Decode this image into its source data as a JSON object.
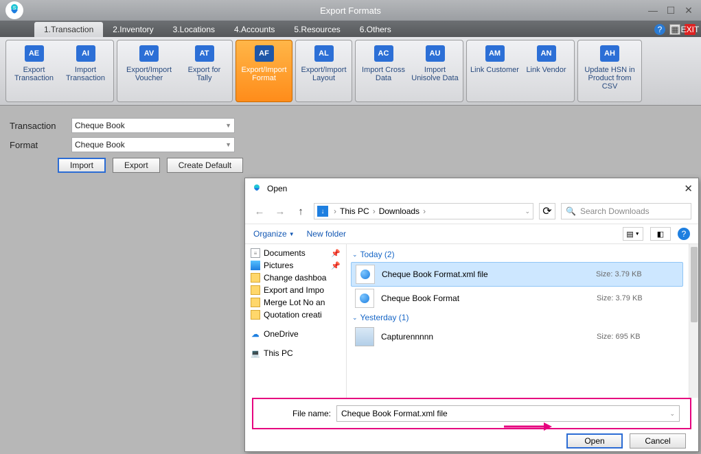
{
  "window": {
    "title": "Export Formats"
  },
  "tabs": [
    "1.Transaction",
    "2.Inventory",
    "3.Locations",
    "4.Accounts",
    "5.Resources",
    "6.Others"
  ],
  "active_tab": 0,
  "ribbon": [
    {
      "items": [
        {
          "label": "Export Transaction",
          "code": "AE"
        },
        {
          "label": "Import Transaction",
          "code": "AI"
        }
      ]
    },
    {
      "items": [
        {
          "label": "Export/Import Voucher",
          "code": "AV"
        },
        {
          "label": "Export for Tally",
          "code": "AT"
        }
      ]
    },
    {
      "items": [
        {
          "label": "Export/Import Format",
          "code": "AF"
        }
      ],
      "highlight": true
    },
    {
      "items": [
        {
          "label": "Export/Import Layout",
          "code": "AL"
        }
      ]
    },
    {
      "items": [
        {
          "label": "Import Cross Data",
          "code": "AC"
        },
        {
          "label": "Import Unisolve Data",
          "code": "AU"
        }
      ]
    },
    {
      "items": [
        {
          "label": "Link Customer",
          "code": "AM"
        },
        {
          "label": "Link Vendor",
          "code": "AN"
        }
      ]
    },
    {
      "items": [
        {
          "label": "Update HSN in Product from CSV",
          "code": "AH"
        }
      ]
    }
  ],
  "form": {
    "transaction_label": "Transaction",
    "transaction_value": "Cheque Book",
    "format_label": "Format",
    "format_value": "Cheque Book",
    "buttons": {
      "import": "Import",
      "export": "Export",
      "create_default": "Create Default"
    }
  },
  "dialog": {
    "title": "Open",
    "breadcrumb": [
      "This PC",
      "Downloads"
    ],
    "search_placeholder": "Search Downloads",
    "toolbar": {
      "organize": "Organize",
      "new_folder": "New folder"
    },
    "tree": [
      {
        "label": "Documents",
        "icon": "doc",
        "pinned": true
      },
      {
        "label": "Pictures",
        "icon": "pic",
        "pinned": true
      },
      {
        "label": "Change dashboa",
        "icon": "folder"
      },
      {
        "label": "Export and Impo",
        "icon": "folder"
      },
      {
        "label": "Merge Lot No an",
        "icon": "folder"
      },
      {
        "label": "Quotation creati",
        "icon": "folder"
      },
      {
        "label": "OneDrive",
        "icon": "od",
        "spaced": true
      },
      {
        "label": "This PC",
        "icon": "pc",
        "spaced": true
      }
    ],
    "groups": [
      {
        "header": "Today (2)",
        "files": [
          {
            "name": "Cheque Book Format.xml file",
            "size": "Size: 3.79 KB",
            "icon": "globe",
            "selected": true
          },
          {
            "name": "Cheque Book Format",
            "size": "Size: 3.79 KB",
            "icon": "globe"
          }
        ]
      },
      {
        "header": "Yesterday (1)",
        "files": [
          {
            "name": "Capturennnnn",
            "size": "Size: 695 KB",
            "icon": "cap"
          }
        ]
      }
    ],
    "file_name_label": "File name:",
    "file_name_value": "Cheque Book Format.xml file",
    "buttons": {
      "open": "Open",
      "cancel": "Cancel"
    }
  }
}
